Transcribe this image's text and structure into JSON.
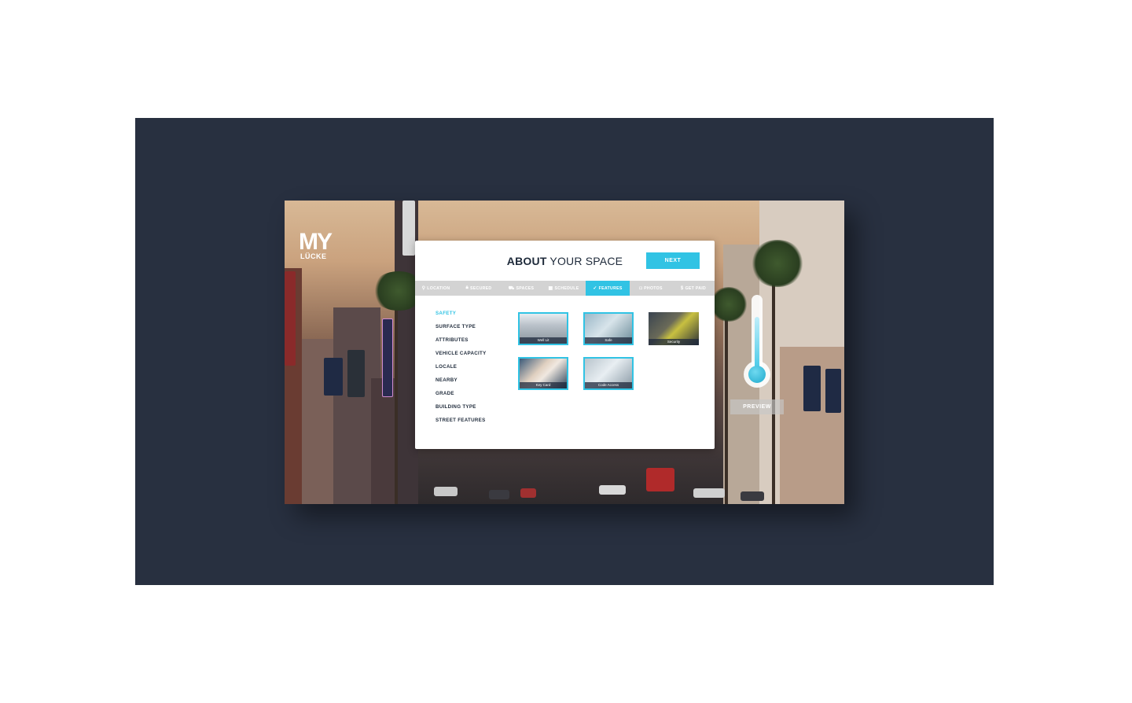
{
  "brand": {
    "logo_mark": "MY",
    "logo_sub": "LÜCKE"
  },
  "modal": {
    "title_bold": "ABOUT",
    "title_rest": " YOUR SPACE",
    "next_label": "NEXT"
  },
  "tabs": [
    {
      "label": "LOCATION",
      "icon": "map-pin-icon",
      "glyph": "⚲",
      "active": false
    },
    {
      "label": "SECURED",
      "icon": "lock-icon",
      "glyph": "🔒︎",
      "active": false
    },
    {
      "label": "SPACES",
      "icon": "car-icon",
      "glyph": "⛟",
      "active": false
    },
    {
      "label": "SCHEDULE",
      "icon": "calendar-icon",
      "glyph": "▦",
      "active": false
    },
    {
      "label": "FEATURES",
      "icon": "check-icon",
      "glyph": "✓",
      "active": true
    },
    {
      "label": "PHOTOS",
      "icon": "camera-icon",
      "glyph": "◘",
      "active": false
    },
    {
      "label": "GET PAID",
      "icon": "dollar-icon",
      "glyph": "$",
      "active": false
    }
  ],
  "categories": [
    {
      "label": "SAFETY",
      "active": true
    },
    {
      "label": "SURFACE TYPE",
      "active": false
    },
    {
      "label": "ATTRIBUTES",
      "active": false
    },
    {
      "label": "VEHICLE CAPACITY",
      "active": false
    },
    {
      "label": "LOCALE",
      "active": false
    },
    {
      "label": "NEARBY",
      "active": false
    },
    {
      "label": "GRADE",
      "active": false
    },
    {
      "label": "BUILDING TYPE",
      "active": false
    },
    {
      "label": "STREET FEATURES",
      "active": false
    }
  ],
  "features": [
    {
      "label": "Well Lit",
      "selected": true
    },
    {
      "label": "Safe",
      "selected": true
    },
    {
      "label": "Security",
      "selected": false
    },
    {
      "label": "Key Card",
      "selected": true
    },
    {
      "label": "Code Access",
      "selected": true
    }
  ],
  "preview_label": "PREVIEW",
  "colors": {
    "accent": "#31c3e4",
    "frame": "#283040",
    "text_dark": "#1e2a3a",
    "tab_bar": "#d3d3d3"
  }
}
